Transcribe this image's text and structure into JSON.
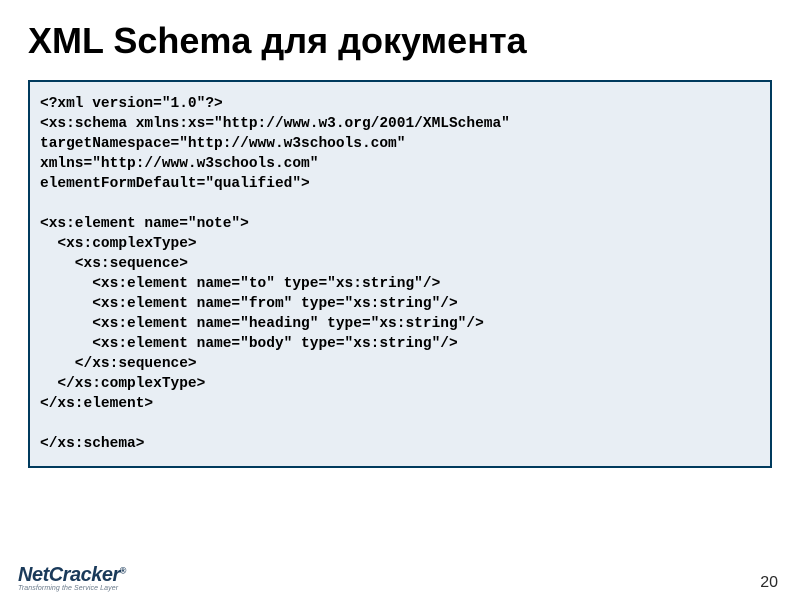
{
  "title": "XML Schema для документа",
  "code": "<?xml version=\"1.0\"?>\n<xs:schema xmlns:xs=\"http://www.w3.org/2001/XMLSchema\"\ntargetNamespace=\"http://www.w3schools.com\"\nxmlns=\"http://www.w3schools.com\"\nelementFormDefault=\"qualified\">\n\n<xs:element name=\"note\">\n  <xs:complexType>\n    <xs:sequence>\n      <xs:element name=\"to\" type=\"xs:string\"/>\n      <xs:element name=\"from\" type=\"xs:string\"/>\n      <xs:element name=\"heading\" type=\"xs:string\"/>\n      <xs:element name=\"body\" type=\"xs:string\"/>\n    </xs:sequence>\n  </xs:complexType>\n</xs:element>\n\n</xs:schema>",
  "logo": {
    "main": "NetCracker",
    "reg": "®",
    "tagline": "Transforming the Service Layer"
  },
  "page_number": "20"
}
